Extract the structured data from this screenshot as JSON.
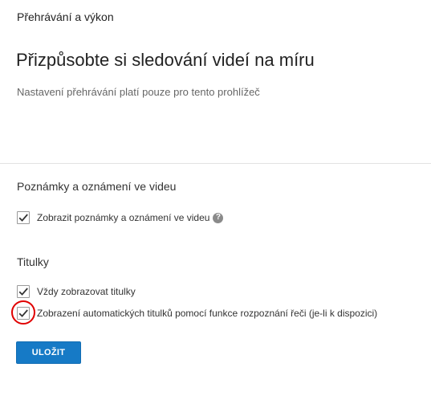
{
  "header": {
    "section_label": "Přehrávání a výkon",
    "title": "Přizpůsobte si sledování videí na míru",
    "subtitle": "Nastavení přehrávání platí pouze pro tento prohlížeč"
  },
  "annotations": {
    "heading": "Poznámky a oznámení ve videu",
    "options": [
      {
        "label": "Zobrazit poznámky a oznámení ve videu",
        "checked": true,
        "help_icon": "question-mark-circle"
      }
    ]
  },
  "subtitles": {
    "heading": "Titulky",
    "options": [
      {
        "label": "Vždy zobrazovat titulky",
        "checked": true
      },
      {
        "label": "Zobrazení automatických titulků pomocí funkce rozpoznání řeči (je-li k dispozici)",
        "checked": true,
        "highlighted": true
      }
    ]
  },
  "actions": {
    "save_label": "ULOŽIT"
  },
  "colors": {
    "button_bg": "#167ac6",
    "highlight": "#e00000",
    "checkmark": "#333333"
  }
}
